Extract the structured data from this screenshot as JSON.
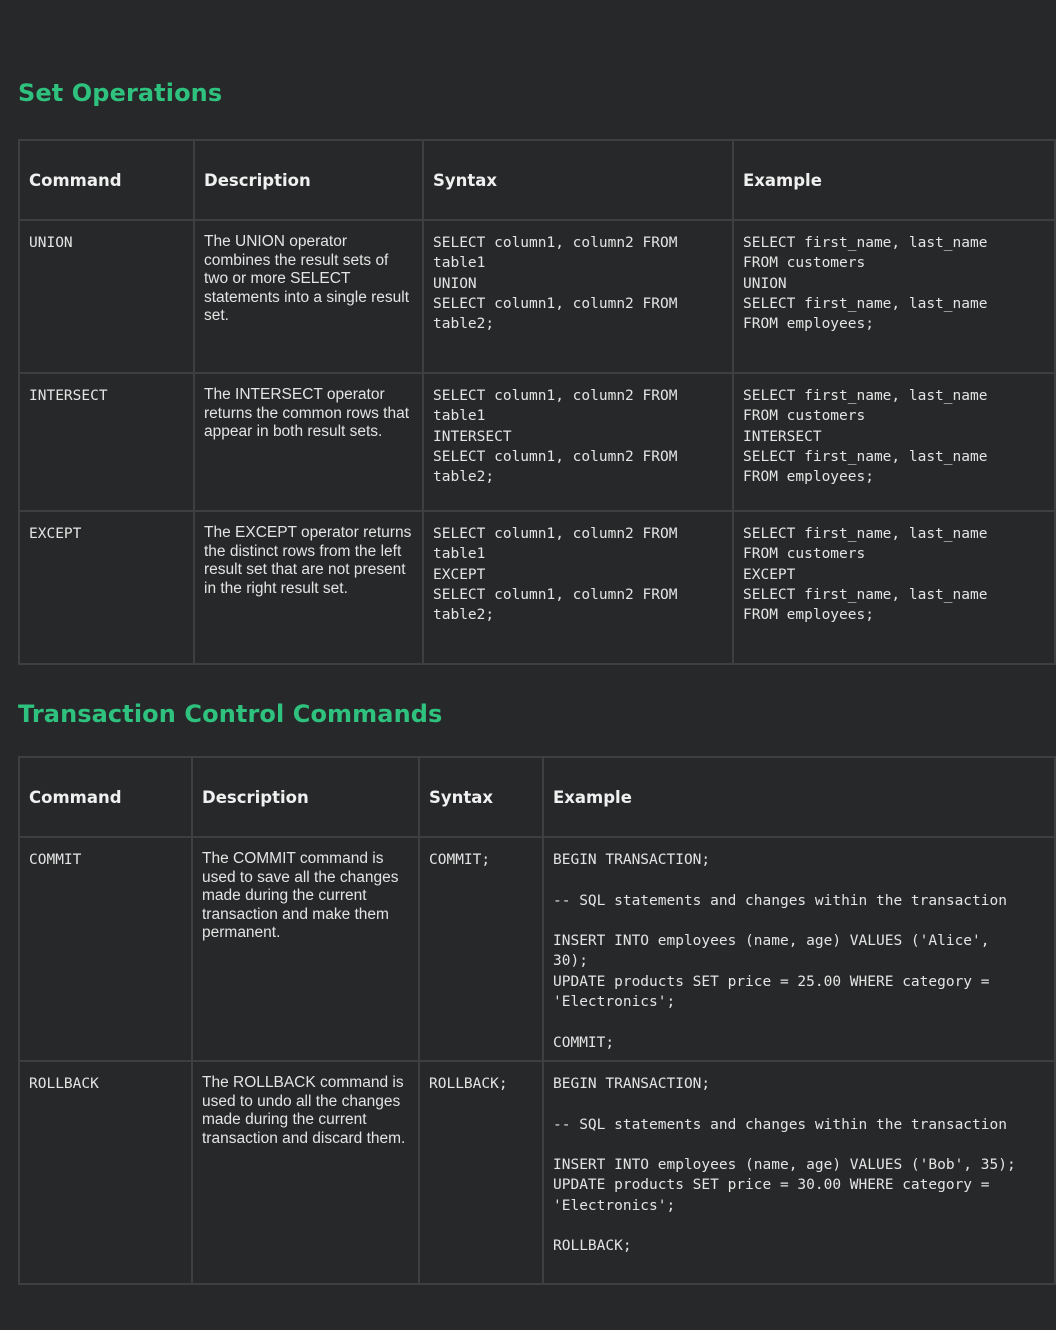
{
  "sections": [
    {
      "title": "Set Operations",
      "headers": [
        "Command",
        "Description",
        "Syntax",
        "Example"
      ],
      "rows": [
        {
          "command": "UNION",
          "description": "The UNION operator combines the result sets of two or more SELECT statements into a single result set.",
          "syntax": "SELECT column1, column2 FROM\ntable1\nUNION\nSELECT column1, column2 FROM\ntable2;",
          "example": "SELECT first_name, last_name\nFROM customers\nUNION\nSELECT first_name, last_name\nFROM employees;"
        },
        {
          "command": "INTERSECT",
          "description": "The INTERSECT operator returns the common rows that appear in both result sets.",
          "syntax": "SELECT column1, column2 FROM\ntable1\nINTERSECT\nSELECT column1, column2 FROM\ntable2;",
          "example": "SELECT first_name, last_name\nFROM customers\nINTERSECT\nSELECT first_name, last_name\nFROM employees;"
        },
        {
          "command": "EXCEPT",
          "description": "The EXCEPT operator returns the distinct rows from the left result set that are not present in the right result set.",
          "syntax": "SELECT column1, column2 FROM\ntable1\nEXCEPT\nSELECT column1, column2 FROM\ntable2;",
          "example": "SELECT first_name, last_name\nFROM customers\nEXCEPT\nSELECT first_name, last_name\nFROM employees;"
        }
      ]
    },
    {
      "title": "Transaction Control Commands",
      "headers": [
        "Command",
        "Description",
        "Syntax",
        "Example"
      ],
      "rows": [
        {
          "command": "COMMIT",
          "description": "The COMMIT command is used to save all the changes made during the current transaction and make them permanent.",
          "syntax": "COMMIT;",
          "example": "BEGIN TRANSACTION;\n\n-- SQL statements and changes within the transaction\n\nINSERT INTO employees (name, age) VALUES ('Alice',\n30);\nUPDATE products SET price = 25.00 WHERE category =\n'Electronics';\n\nCOMMIT;"
        },
        {
          "command": "ROLLBACK",
          "description": "The ROLLBACK command is used to undo all the changes made during the current transaction and discard them.",
          "syntax": "ROLLBACK;",
          "example": "BEGIN TRANSACTION;\n\n-- SQL statements and changes within the transaction\n\nINSERT INTO employees (name, age) VALUES ('Bob', 35);\nUPDATE products SET price = 30.00 WHERE category =\n'Electronics';\n\nROLLBACK;"
        }
      ]
    }
  ],
  "colors": {
    "background": "#272829",
    "accent": "#2ec27e",
    "border": "#3d3f40",
    "text": "#e4e4e4"
  }
}
